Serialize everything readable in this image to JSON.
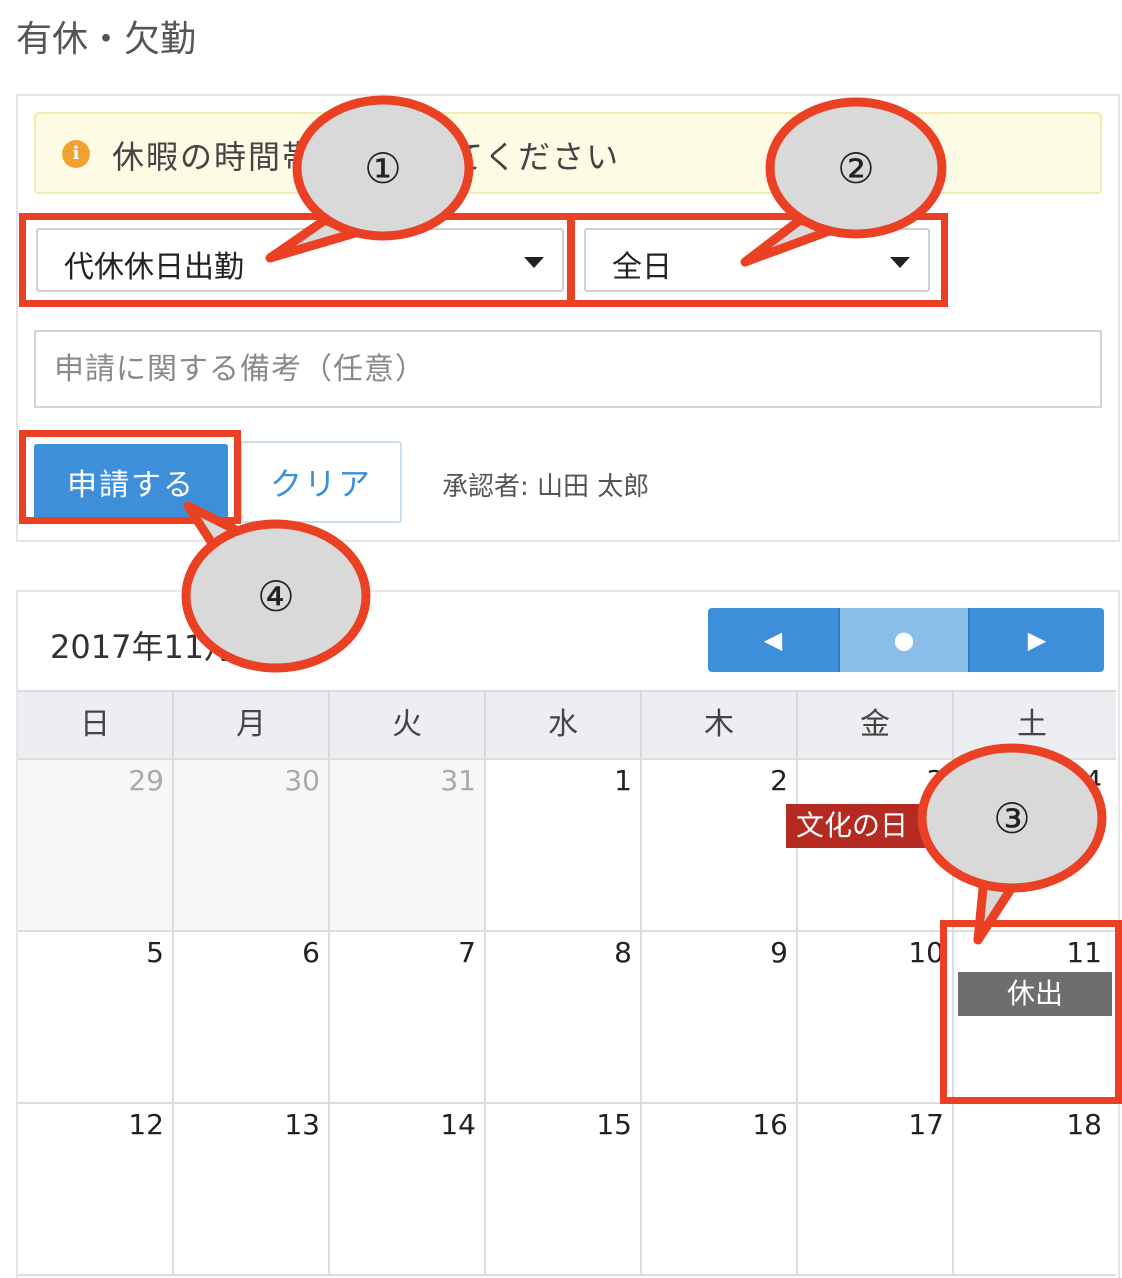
{
  "page": {
    "title": "有休・欠勤"
  },
  "alert": {
    "text": "休暇の時間帯を選択してください"
  },
  "form": {
    "leave_type": "代休休日出勤",
    "period": "全日",
    "memo_placeholder": "申請に関する備考（任意）",
    "submit_label": "申請する",
    "clear_label": "クリア",
    "approver": "承認者: 山田 太郎"
  },
  "calendar": {
    "title": "2017年11月",
    "nav": {
      "prev": "◀",
      "today": "●",
      "next": "▶"
    },
    "weekdays": [
      "日",
      "月",
      "火",
      "水",
      "木",
      "金",
      "土"
    ],
    "weeks": [
      [
        "29",
        "30",
        "31",
        "1",
        "2",
        "3",
        "4"
      ],
      [
        "5",
        "6",
        "7",
        "8",
        "9",
        "10",
        "11"
      ],
      [
        "12",
        "13",
        "14",
        "15",
        "16",
        "17",
        "18"
      ]
    ],
    "events": {
      "holiday": "文化の日",
      "work": "休出"
    }
  },
  "annotations": {
    "n1": "①",
    "n2": "②",
    "n3": "③",
    "n4": "④"
  },
  "colors": {
    "annotation": "#ea4023",
    "bubble": "#d9d9d9",
    "primary": "#3d8fd9",
    "holiday": "#b52a21",
    "work": "#6e6e6e"
  }
}
